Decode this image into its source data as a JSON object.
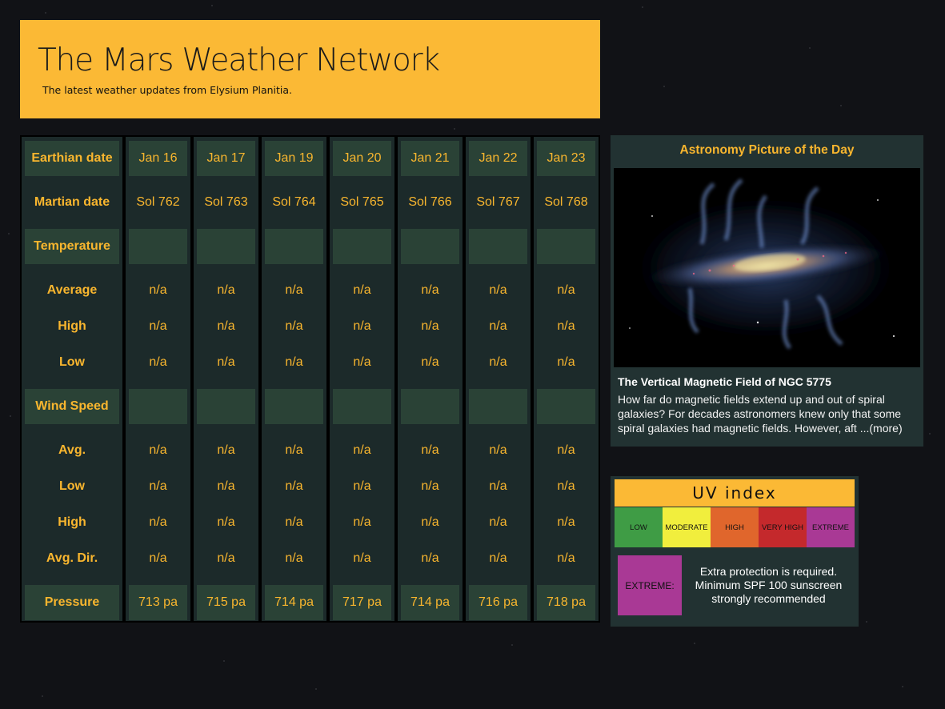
{
  "header": {
    "title": "The Mars Weather Network",
    "subtitle": "The latest weather updates from Elysium Planitia."
  },
  "table": {
    "labels": {
      "earth_date": "Earthian date",
      "martian_date": "Martian date",
      "temperature": "Temperature",
      "temp_avg": "Average",
      "temp_high": "High",
      "temp_low": "Low",
      "wind_speed": "Wind Speed",
      "wind_avg": "Avg.",
      "wind_low": "Low",
      "wind_high": "High",
      "wind_dir": "Avg. Dir.",
      "pressure": "Pressure"
    },
    "days": [
      {
        "earth_date": "Jan 16",
        "sol": "Sol 762",
        "temp_avg": "n/a",
        "temp_high": "n/a",
        "temp_low": "n/a",
        "wind_avg": "n/a",
        "wind_low": "n/a",
        "wind_high": "n/a",
        "wind_dir": "n/a",
        "pressure": "713 pa"
      },
      {
        "earth_date": "Jan 17",
        "sol": "Sol 763",
        "temp_avg": "n/a",
        "temp_high": "n/a",
        "temp_low": "n/a",
        "wind_avg": "n/a",
        "wind_low": "n/a",
        "wind_high": "n/a",
        "wind_dir": "n/a",
        "pressure": "715 pa"
      },
      {
        "earth_date": "Jan 19",
        "sol": "Sol 764",
        "temp_avg": "n/a",
        "temp_high": "n/a",
        "temp_low": "n/a",
        "wind_avg": "n/a",
        "wind_low": "n/a",
        "wind_high": "n/a",
        "wind_dir": "n/a",
        "pressure": "714 pa"
      },
      {
        "earth_date": "Jan 20",
        "sol": "Sol 765",
        "temp_avg": "n/a",
        "temp_high": "n/a",
        "temp_low": "n/a",
        "wind_avg": "n/a",
        "wind_low": "n/a",
        "wind_high": "n/a",
        "wind_dir": "n/a",
        "pressure": "717 pa"
      },
      {
        "earth_date": "Jan 21",
        "sol": "Sol 766",
        "temp_avg": "n/a",
        "temp_high": "n/a",
        "temp_low": "n/a",
        "wind_avg": "n/a",
        "wind_low": "n/a",
        "wind_high": "n/a",
        "wind_dir": "n/a",
        "pressure": "714 pa"
      },
      {
        "earth_date": "Jan 22",
        "sol": "Sol 767",
        "temp_avg": "n/a",
        "temp_high": "n/a",
        "temp_low": "n/a",
        "wind_avg": "n/a",
        "wind_low": "n/a",
        "wind_high": "n/a",
        "wind_dir": "n/a",
        "pressure": "716 pa"
      },
      {
        "earth_date": "Jan 23",
        "sol": "Sol 768",
        "temp_avg": "n/a",
        "temp_high": "n/a",
        "temp_low": "n/a",
        "wind_avg": "n/a",
        "wind_low": "n/a",
        "wind_high": "n/a",
        "wind_dir": "n/a",
        "pressure": "718 pa"
      }
    ]
  },
  "apod": {
    "section_title": "Astronomy Picture of the Day",
    "image_title": "The Vertical Magnetic Field of NGC 5775",
    "explanation": "How far do magnetic fields extend up and out of spiral galaxies? For decades astronomers knew only that some spiral galaxies had magnetic fields. However, aft ...",
    "more_link": "(more)"
  },
  "uv": {
    "title": "UV index",
    "levels": [
      {
        "label": "LOW",
        "color": "#3f9c45"
      },
      {
        "label": "MODERATE",
        "color": "#f1ee3d"
      },
      {
        "label": "HIGH",
        "color": "#e0662c"
      },
      {
        "label": "VERY HIGH",
        "color": "#c4292c"
      },
      {
        "label": "EXTREME",
        "color": "#a93995"
      }
    ],
    "current_label": "EXTREME:",
    "current_color": "#a93995",
    "description": "Extra protection is required. Minimum SPF 100 sunscreen strongly recommended"
  },
  "colors": {
    "accent": "#fbb935",
    "label_text": "#f9b62e",
    "column_bg": "#1c2a2a",
    "header_cell_bg": "#2a4236"
  }
}
